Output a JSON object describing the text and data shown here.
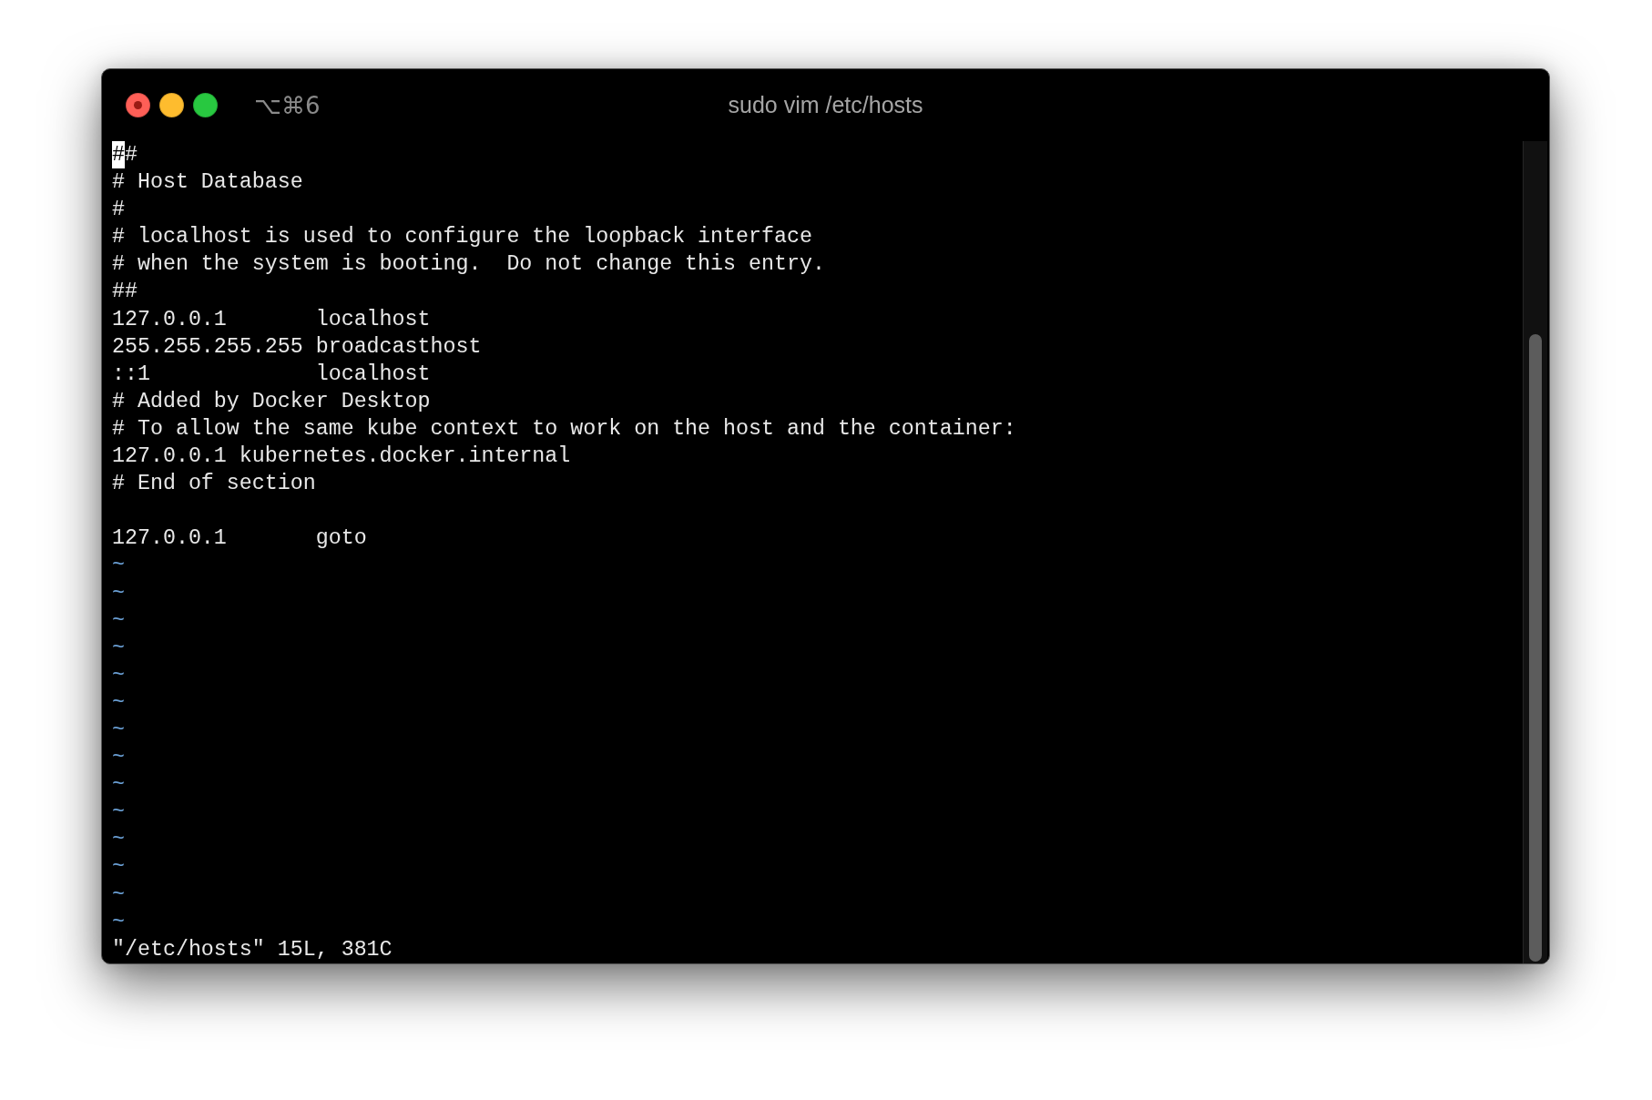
{
  "window": {
    "title": "sudo vim /etc/hosts",
    "shortcut": "⌥⌘6",
    "controls": [
      {
        "kind": "close"
      },
      {
        "kind": "minimize"
      },
      {
        "kind": "zoom"
      }
    ]
  },
  "editor": {
    "lines": [
      {
        "kind": "text",
        "text": "##",
        "cursor": true
      },
      {
        "kind": "text",
        "text": "# Host Database"
      },
      {
        "kind": "text",
        "text": "#"
      },
      {
        "kind": "text",
        "text": "# localhost is used to configure the loopback interface"
      },
      {
        "kind": "text",
        "text": "# when the system is booting.  Do not change this entry."
      },
      {
        "kind": "text",
        "text": "##"
      },
      {
        "kind": "text",
        "text": "127.0.0.1       localhost"
      },
      {
        "kind": "text",
        "text": "255.255.255.255 broadcasthost"
      },
      {
        "kind": "text",
        "text": "::1             localhost"
      },
      {
        "kind": "text",
        "text": "# Added by Docker Desktop"
      },
      {
        "kind": "text",
        "text": "# To allow the same kube context to work on the host and the container:"
      },
      {
        "kind": "text",
        "text": "127.0.0.1 kubernetes.docker.internal"
      },
      {
        "kind": "text",
        "text": "# End of section"
      },
      {
        "kind": "blank"
      },
      {
        "kind": "text",
        "text": "127.0.0.1       goto"
      },
      {
        "kind": "tilde",
        "text": "~"
      },
      {
        "kind": "tilde",
        "text": "~"
      },
      {
        "kind": "tilde",
        "text": "~"
      },
      {
        "kind": "tilde",
        "text": "~"
      },
      {
        "kind": "tilde",
        "text": "~"
      },
      {
        "kind": "tilde",
        "text": "~"
      },
      {
        "kind": "tilde",
        "text": "~"
      },
      {
        "kind": "tilde",
        "text": "~"
      },
      {
        "kind": "tilde",
        "text": "~"
      },
      {
        "kind": "tilde",
        "text": "~"
      },
      {
        "kind": "tilde",
        "text": "~"
      },
      {
        "kind": "tilde",
        "text": "~"
      },
      {
        "kind": "tilde",
        "text": "~"
      },
      {
        "kind": "tilde",
        "text": "~"
      }
    ],
    "status": "\"/etc/hosts\" 15L, 381C"
  }
}
